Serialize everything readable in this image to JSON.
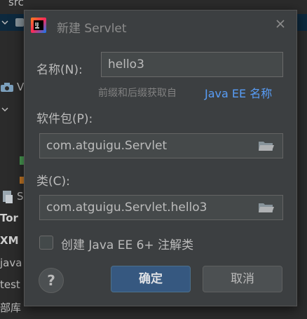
{
  "background": {
    "tree_items": [
      "src",
      "V",
      "S",
      "Tor",
      "XM",
      "java",
      "test",
      "部库"
    ]
  },
  "dialog": {
    "title": "新建 Servlet",
    "name_label": "名称(N):",
    "name_value": "hello3",
    "hint_text": "前缀和后缀获取自",
    "hint_link": "Java EE 名称",
    "package_label": "软件包(P):",
    "package_value": "com.atguigu.Servlet",
    "class_label": "类(C):",
    "class_value": "com.atguigu.Servlet.hello3",
    "checkbox_label": "创建 Java EE 6+ 注解类",
    "checkbox_checked": false,
    "help_label": "?",
    "ok_label": "确定",
    "cancel_label": "取消"
  },
  "colors": {
    "dialog_bg": "#3c3f41",
    "input_bg": "#45494a",
    "link": "#589df6",
    "primary_button": "#365880"
  },
  "icons": [
    "intellij-app-icon",
    "close-icon",
    "folder-icon",
    "help-icon"
  ]
}
